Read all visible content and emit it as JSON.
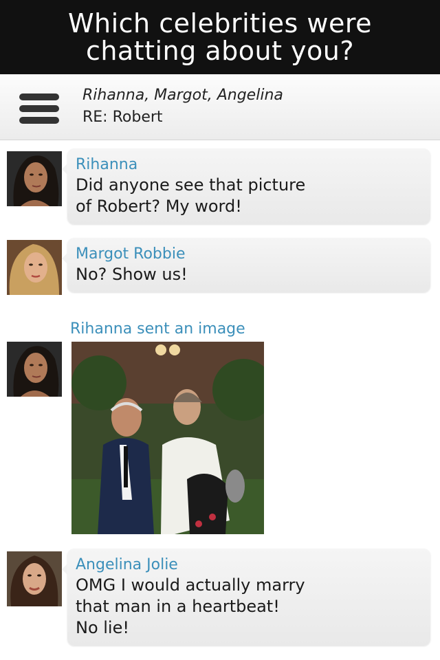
{
  "banner": {
    "line1": "Which celebrities were",
    "line2": "chatting about you?"
  },
  "header": {
    "participants": "Rihanna, Margot, Angelina",
    "subject": "RE: Robert",
    "menu_icon": "hamburger-menu-icon"
  },
  "messages": [
    {
      "sender": "Rihanna",
      "lines": [
        "Did anyone see that picture",
        "of Robert? My word!"
      ]
    },
    {
      "sender": "Margot Robbie",
      "lines": [
        "No? Show us!"
      ]
    },
    {
      "sender": "Angelina Jolie",
      "lines": [
        "OMG I would actually marry",
        "that man in a heartbeat!",
        "No lie!"
      ]
    }
  ],
  "image_message": {
    "label": "Rihanna sent an image"
  },
  "colors": {
    "banner_bg": "#111111",
    "sender_name": "#3b8fba",
    "bubble_bg": "#eeeeee"
  }
}
